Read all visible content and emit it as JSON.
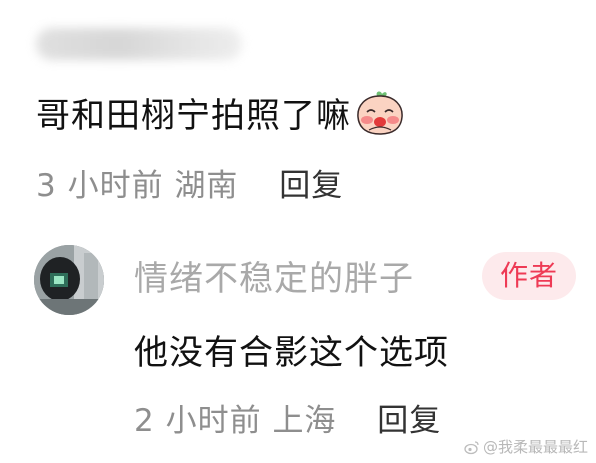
{
  "comment": {
    "text": "哥和田栩宁拍照了嘛",
    "emoji": "blushing-peach-emoji",
    "time": "3 小时前",
    "location": "湖南",
    "reply_label": "回复"
  },
  "reply": {
    "username": "情绪不稳定的胖子",
    "badge": "作者",
    "text": "他没有合影这个选项",
    "time": "2 小时前",
    "location": "上海",
    "reply_label": "回复",
    "avatar": "avatar-photo"
  },
  "watermark": {
    "icon": "weibo-icon",
    "text": "@我柔最最最红"
  },
  "colors": {
    "primary_text": "#111111",
    "secondary_text": "#8e8e8e",
    "username_text": "#a9a9a9",
    "badge_text": "#ee3a55",
    "badge_bg": "#fdeaec"
  }
}
